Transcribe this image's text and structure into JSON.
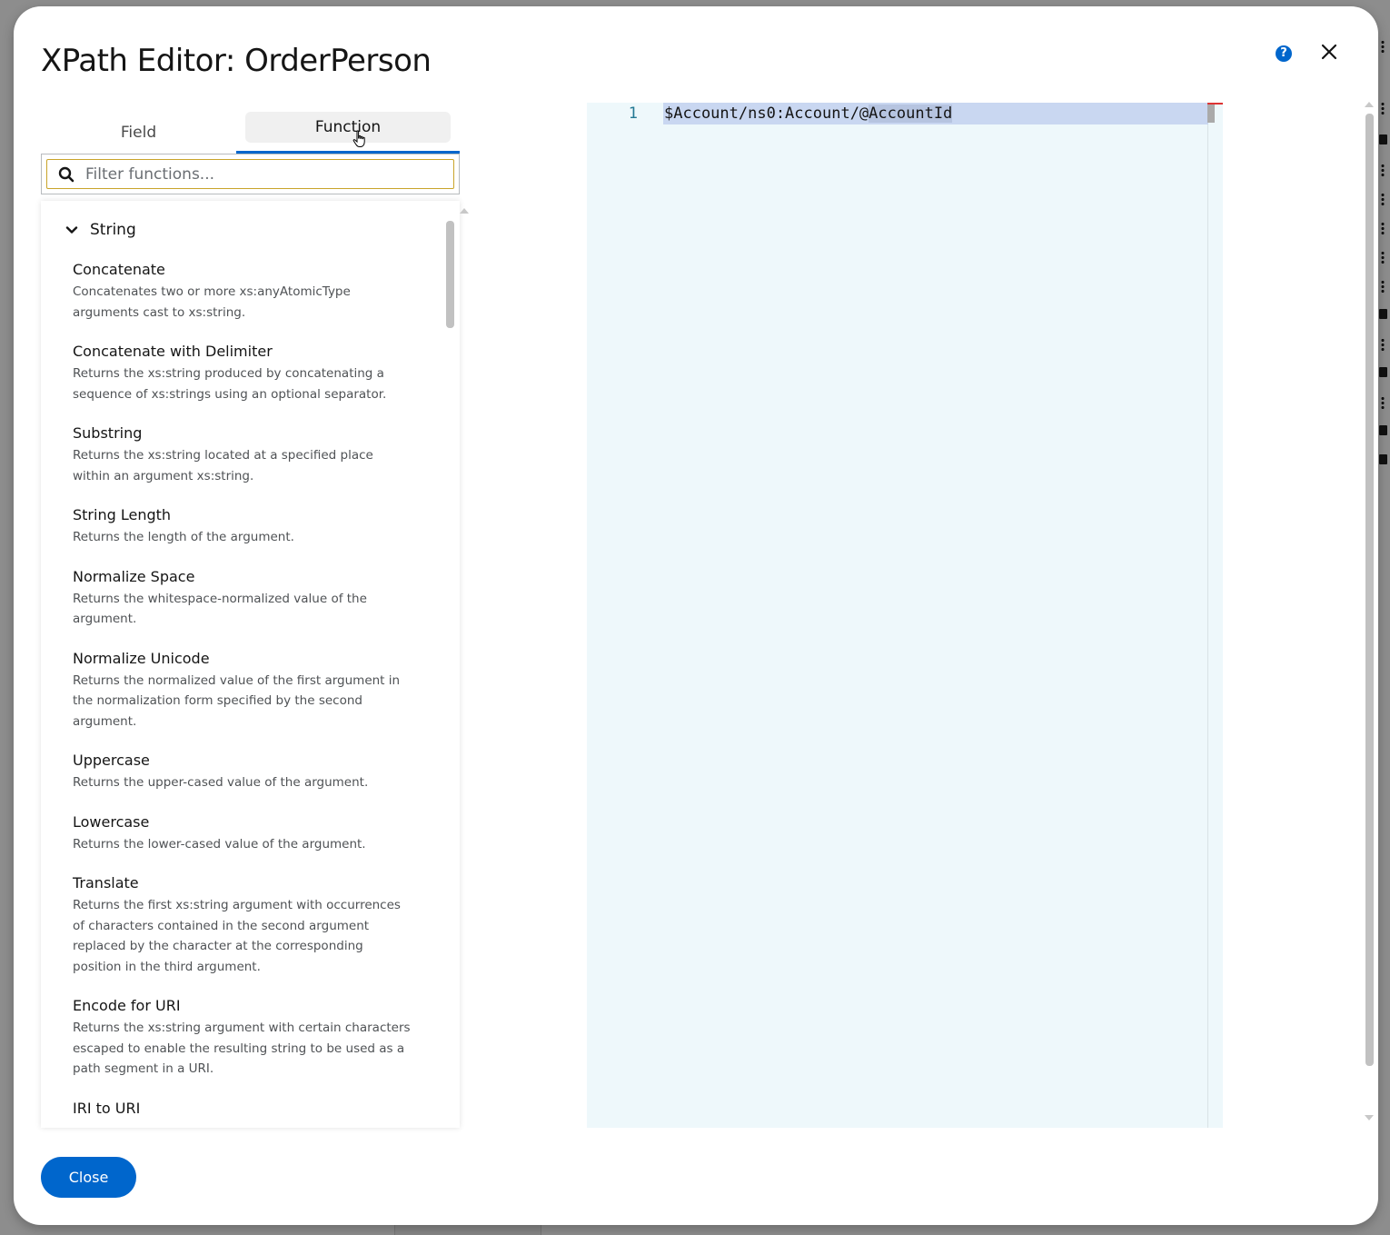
{
  "modal": {
    "title": "XPath Editor: OrderPerson",
    "help_icon": "help-circle-icon",
    "close_icon": "close-icon"
  },
  "tabs": [
    {
      "label": "Field",
      "selected": false
    },
    {
      "label": "Function",
      "selected": true
    }
  ],
  "filter": {
    "placeholder": "Filter functions...",
    "value": ""
  },
  "function_group": {
    "label": "String",
    "expanded": true,
    "items": [
      {
        "name": "Concatenate",
        "description": "Concatenates two or more xs:anyAtomicType arguments cast to xs:string."
      },
      {
        "name": "Concatenate with Delimiter",
        "description": "Returns the xs:string produced by concatenating a sequence of xs:strings using an optional separator."
      },
      {
        "name": "Substring",
        "description": "Returns the xs:string located at a specified place within an argument xs:string."
      },
      {
        "name": "String Length",
        "description": "Returns the length of the argument."
      },
      {
        "name": "Normalize Space",
        "description": "Returns the whitespace-normalized value of the argument."
      },
      {
        "name": "Normalize Unicode",
        "description": "Returns the normalized value of the first argument in the normalization form specified by the second argument."
      },
      {
        "name": "Uppercase",
        "description": "Returns the upper-cased value of the argument."
      },
      {
        "name": "Lowercase",
        "description": "Returns the lower-cased value of the argument."
      },
      {
        "name": "Translate",
        "description": "Returns the first xs:string argument with occurrences of characters contained in the second argument replaced by the character at the corresponding position in the third argument."
      },
      {
        "name": "Encode for URI",
        "description": "Returns the xs:string argument with certain characters escaped to enable the resulting string to be used as a path segment in a URI."
      },
      {
        "name": "IRI to URI",
        "description": ""
      }
    ]
  },
  "editor": {
    "line_number": "1",
    "code_before_selection": "$Account/ns0:Account/@",
    "code_selected": "AccountId"
  },
  "footer": {
    "close_label": "Close"
  },
  "colors": {
    "primary": "#0066cc",
    "editor_bg": "#eef8fb",
    "line_highlight": "#c9d7f1",
    "filter_focus": "#c9a42a"
  }
}
